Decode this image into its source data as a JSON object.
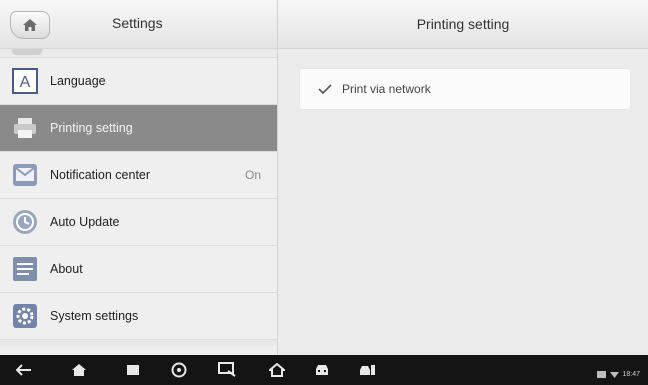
{
  "header": {
    "left_title": "Settings",
    "right_title": "Printing setting"
  },
  "sidebar": {
    "items": [
      {
        "label": "Language",
        "icon": "language-icon",
        "value": ""
      },
      {
        "label": "Printing setting",
        "icon": "printer-icon",
        "value": "",
        "selected": true
      },
      {
        "label": "Notification center",
        "icon": "notification-icon",
        "value": "On"
      },
      {
        "label": "Auto Update",
        "icon": "auto-update-icon",
        "value": ""
      },
      {
        "label": "About",
        "icon": "about-icon",
        "value": ""
      },
      {
        "label": "System settings",
        "icon": "system-settings-icon",
        "value": ""
      }
    ]
  },
  "printing": {
    "option_label": "Print via network",
    "checked": true
  },
  "navbar": {
    "buttons": [
      "back-icon",
      "home-icon",
      "recent-apps-icon",
      "browser-icon",
      "remote-desk-icon",
      "maxisys-home-icon",
      "car-icon",
      "vci-icon"
    ],
    "status_time": "18:47"
  },
  "colors": {
    "selected_row": "#8a8a8a",
    "navbar": "#141414",
    "content_bg": "#ebebeb"
  }
}
